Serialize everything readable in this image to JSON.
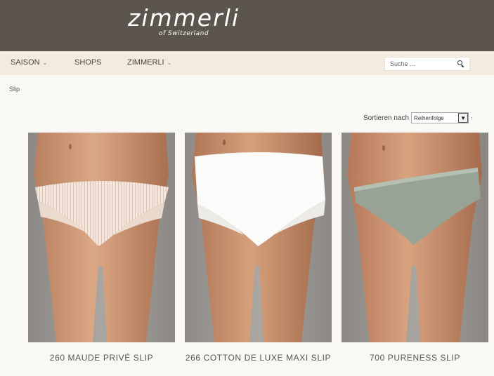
{
  "header": {
    "logo_main": "zimmerli",
    "logo_sub": "of Switzerland",
    "background": "#5b554d"
  },
  "nav": {
    "items": [
      {
        "label": "SAISON",
        "has_dropdown": true
      },
      {
        "label": "SHOPS",
        "has_dropdown": false
      },
      {
        "label": "ZIMMERLI",
        "has_dropdown": true
      }
    ],
    "search": {
      "placeholder": "Suche ...",
      "icon": "search-icon"
    }
  },
  "breadcrumb": "Slip",
  "sort": {
    "label": "Sortieren nach",
    "selected": "Reihenfolge",
    "extra": "↑"
  },
  "products": [
    {
      "name": "260 MAUDE PRIVÉ SLIP",
      "garment_color": "#f3e6dc"
    },
    {
      "name": "266 COTTON DE LUXE MAXI SLIP",
      "garment_color": "#fbfbfa"
    },
    {
      "name": "700 PURENESS SLIP",
      "garment_color": "#98a396"
    }
  ]
}
